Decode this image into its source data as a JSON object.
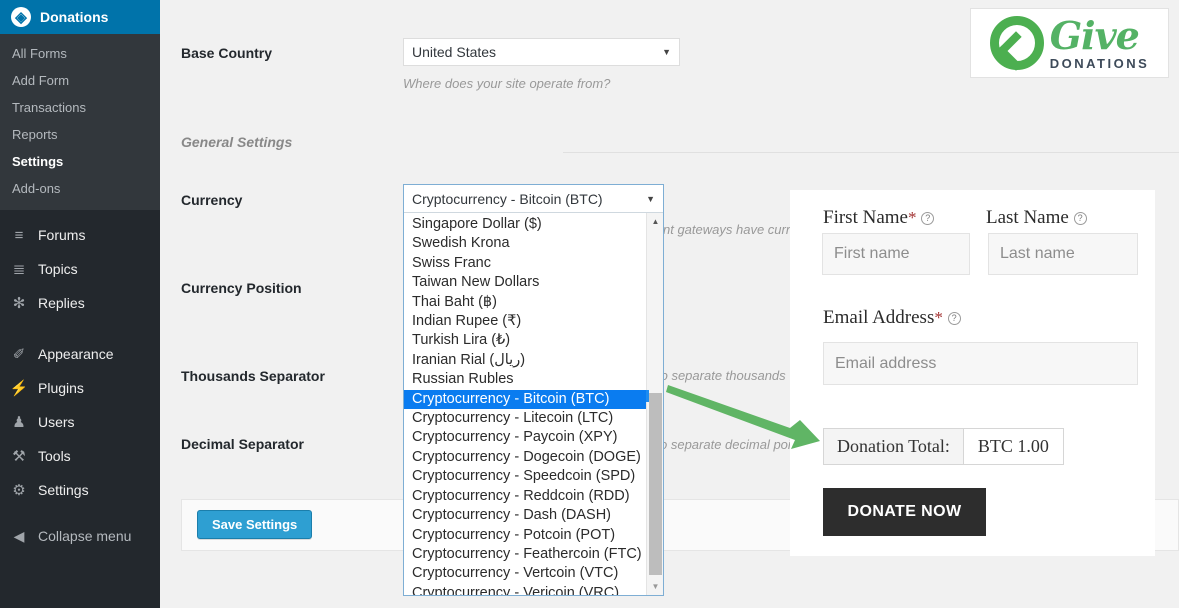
{
  "sidebar": {
    "brand": {
      "label": "Donations",
      "icon": "give-circle-icon"
    },
    "submenu": [
      {
        "label": "All Forms",
        "current": false
      },
      {
        "label": "Add Form",
        "current": false
      },
      {
        "label": "Transactions",
        "current": false
      },
      {
        "label": "Reports",
        "current": false
      },
      {
        "label": "Settings",
        "current": true
      },
      {
        "label": "Add-ons",
        "current": false
      }
    ],
    "group1": [
      {
        "label": "Forums",
        "icon": "forums-icon",
        "glyph": "≡"
      },
      {
        "label": "Topics",
        "icon": "topics-icon",
        "glyph": "≣"
      },
      {
        "label": "Replies",
        "icon": "replies-icon",
        "glyph": "✻"
      }
    ],
    "group2": [
      {
        "label": "Appearance",
        "icon": "appearance-brush-icon",
        "glyph": "✐"
      },
      {
        "label": "Plugins",
        "icon": "plugins-plug-icon",
        "glyph": "⚡"
      },
      {
        "label": "Users",
        "icon": "users-icon",
        "glyph": "♟"
      },
      {
        "label": "Tools",
        "icon": "tools-wrench-icon",
        "glyph": "⚒"
      },
      {
        "label": "Settings",
        "icon": "settings-sliders-icon",
        "glyph": "⚙"
      }
    ],
    "collapse": {
      "label": "Collapse menu",
      "icon": "collapse-left-arrow-icon",
      "glyph": "◀"
    }
  },
  "logo": {
    "give": "Give",
    "donations": "DONATIONS",
    "mark": "give-g-leaf-icon"
  },
  "settings": {
    "base_country": {
      "label": "Base Country",
      "value": "United States",
      "help": "Where does your site operate from?"
    },
    "section_general": "General Settings",
    "currency": {
      "label": "Currency",
      "value": "Cryptocurrency - Bitcoin (BTC)",
      "help_visible": "nt gateways have curre"
    },
    "currency_position": {
      "label": "Currency Position"
    },
    "thousands_separator": {
      "label": "Thousands Separator",
      "help_visible": "to separate thousands"
    },
    "decimal_separator": {
      "label": "Decimal Separator",
      "help_visible": "o separate decimal poi"
    },
    "save_button": "Save Settings"
  },
  "dropdown": {
    "current": "Cryptocurrency - Bitcoin (BTC)",
    "selected": "Cryptocurrency - Bitcoin (BTC)",
    "options": [
      "Singapore Dollar ($)",
      "Swedish Krona",
      "Swiss Franc",
      "Taiwan New Dollars",
      "Thai Baht (฿)",
      "Indian Rupee (₹)",
      "Turkish Lira (₺)",
      "Iranian Rial (ريال)",
      "Russian Rubles",
      "Cryptocurrency - Bitcoin (BTC)",
      "Cryptocurrency - Litecoin (LTC)",
      "Cryptocurrency - Paycoin (XPY)",
      "Cryptocurrency - Dogecoin (DOGE)",
      "Cryptocurrency - Speedcoin (SPD)",
      "Cryptocurrency - Reddcoin (RDD)",
      "Cryptocurrency - Dash (DASH)",
      "Cryptocurrency - Potcoin (POT)",
      "Cryptocurrency - Feathercoin (FTC)",
      "Cryptocurrency - Vertcoin (VTC)",
      "Cryptocurrency - Vericoin (VRC)"
    ],
    "scroll_up_icon": "scroll-up-arrow-icon",
    "scroll_down_icon": "scroll-down-arrow-icon"
  },
  "donation_form": {
    "first_name": {
      "label": "First Name",
      "required": "*",
      "placeholder": "First name",
      "help_icon": "question-mark-icon"
    },
    "last_name": {
      "label": "Last Name",
      "required": "",
      "placeholder": "Last name",
      "help_icon": "question-mark-icon"
    },
    "email": {
      "label": "Email Address",
      "required": "*",
      "placeholder": "Email address",
      "help_icon": "question-mark-icon"
    },
    "total_label": "Donation Total:",
    "total_value": "BTC 1.00",
    "donate_button": "DONATE NOW"
  },
  "annotation": {
    "arrow_color": "#60b565",
    "arrow_icon": "green-pointer-arrow-icon"
  },
  "colors": {
    "admin_blue": "#0073aa",
    "sidebar_dark": "#23282d",
    "submenu_dark": "#32373c",
    "select_highlight": "#0a7cf0",
    "save_button": "#2e9fd2",
    "give_green": "#54b265",
    "donate_dark": "#2d2d2d"
  }
}
